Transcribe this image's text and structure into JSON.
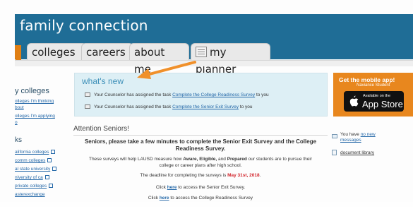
{
  "app": {
    "title": "family connection"
  },
  "tabs": [
    {
      "label": "colleges"
    },
    {
      "label": "careers"
    },
    {
      "label": "about me"
    },
    {
      "label": "my planner"
    }
  ],
  "sidebar": {
    "colleges_heading": "y colleges",
    "links1": [
      "olleges I'm thinking",
      "bout",
      "olleges I'm applying",
      "o"
    ],
    "links_heading": "ks",
    "links2": [
      "alifornia colleges",
      "comm colleges",
      "al state university",
      "niversity of ca",
      "private colleges",
      "asterexchange"
    ]
  },
  "whats_new": {
    "title": "what's new",
    "items": [
      {
        "prefix": "Your Counselor has assigned the task ",
        "link": "Complete the College Readiness Survey",
        "suffix": " to you"
      },
      {
        "prefix": "Your Counselor has assigned the task ",
        "link": "Complete the Senior Exit Survey",
        "suffix": " to you"
      }
    ]
  },
  "ad": {
    "line1": "Get the mobile app!",
    "line2": "Naviance Student",
    "badge_small": "Available on the",
    "badge_big": "App Store"
  },
  "main": {
    "heading": "Attention Seniors!",
    "message_line1": "Seniors, please take a few minutes to complete the Senior Exit Survey and the College",
    "message_line2": "Readiness Survey.",
    "survey_prefix": "These surveys will help LAUSD measure how ",
    "survey_b1": "Aware, Eligible,",
    "survey_mid": " and ",
    "survey_b2": "Prepared",
    "survey_suffix": " our students are to pursue their",
    "survey_line2": "college or career plans after high school.",
    "deadline_prefix": "The deadline for completing the surveys is ",
    "deadline_date": "May 31st, 2018",
    "deadline_suffix": ".",
    "click1_prefix": "Click ",
    "click1_link": "here",
    "click1_suffix": " to access the Senior Exit Survey.",
    "click2_prefix": "Click ",
    "click2_link": "here",
    "click2_suffix": " to access the College Readiness Survey"
  },
  "right": {
    "messages_prefix": "You have ",
    "messages_link": "no new",
    "messages_link2": "messages",
    "doc_link": "document library"
  },
  "colors": {
    "header_blue": "#1f6d96",
    "tab_orange": "#e07f14",
    "arrow_orange": "#f0902a",
    "link_blue": "#2468a8",
    "deadline_red": "#d2232a"
  }
}
